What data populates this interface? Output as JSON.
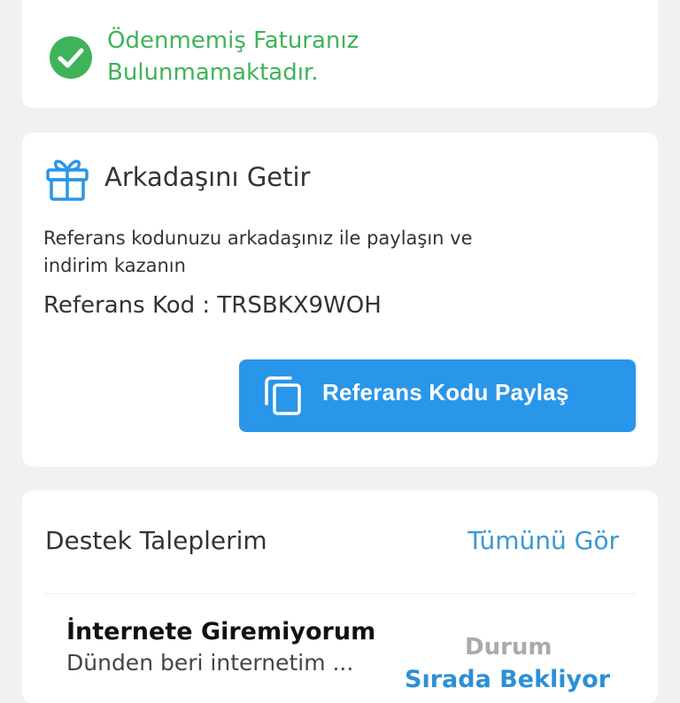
{
  "invoice": {
    "line1": "Ödenmemiş Faturanız",
    "line2": "Bulunmamaktadır."
  },
  "referral": {
    "title": "Arkadaşını Getir",
    "desc_line1": "Referans kodunuzu arkadaşınız ile paylaşın ve",
    "desc_line2": "indirim kazanın",
    "code_text": "Referans Kod : TRSBKX9WOH",
    "share_label": "Referans Kodu Paylaş"
  },
  "support": {
    "title": "Destek Taleplerim",
    "see_all": "Tümünü Gör",
    "ticket": {
      "title": "İnternete Giremiyorum",
      "subtitle": "Dünden beri internetim ...",
      "status_label": "Durum",
      "status_value": "Sırada Bekliyor"
    }
  },
  "colors": {
    "success": "#3fb35a",
    "accent": "#2996ea",
    "link": "#3a98d6",
    "background": "#f1f1f1"
  },
  "icons": {
    "invoice": "check-circle-icon",
    "referral": "gift-icon",
    "share": "copy-icon"
  }
}
